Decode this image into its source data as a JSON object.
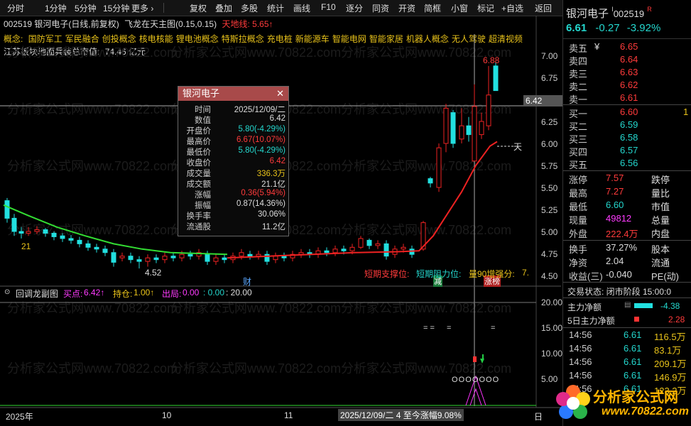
{
  "toolbar_left": [
    "分时",
    "1分钟",
    "5分钟",
    "15分钟",
    "更多 ›"
  ],
  "toolbar_right": [
    "复权",
    "叠加",
    "多股",
    "统计",
    "画线",
    "F10",
    "逐分",
    "同资",
    "开资",
    "简框",
    "小窗",
    "标记",
    "+自选",
    "返回"
  ],
  "chart_header": {
    "code": "002519",
    "name": "银河电子(日线,前复权)",
    "indicator": "飞龙在天主图(0.15,0.15)",
    "tiandi_label": "天地线:",
    "tiandi_value": "5.65↑"
  },
  "concepts": {
    "label": "概念:",
    "items": [
      "国防军工",
      "军民融合",
      "创投概念",
      "核电核能",
      "锂电池概念",
      "特斯拉概念",
      "充电桩",
      "新能源车",
      "智能电网",
      "智能家居",
      "机器人概念",
      "无人驾驶",
      "超清视频"
    ]
  },
  "info_line": {
    "region": "江苏板块地面兵装总市值:",
    "value": "74.46 亿元"
  },
  "watermark": "分析家公式网www.70822.com",
  "y_axis_main": [
    "7.00",
    "6.75",
    "6.50",
    "6.25",
    "6.00",
    "5.75",
    "5.50",
    "5.25",
    "5.00",
    "4.75",
    "4.50"
  ],
  "y_axis_lower": [
    "20.00",
    "15.00",
    "10.00",
    "5.00"
  ],
  "current_price_tag": "6.42",
  "chart_labels": {
    "peak": "6.88",
    "low_marker": "4.52",
    "start_level": "21",
    "tian_label": "天",
    "cai": "财",
    "jian": "减",
    "zhangbang": "涨榜",
    "short_support": "短期支撑位:",
    "short_resist": "短期阻力位:",
    "gain_strong": "量90增强分:",
    "gain_value": "7."
  },
  "popup": {
    "title": "银河电子",
    "close": "✕",
    "rows": [
      {
        "label": "时间",
        "value": "2025/12/09/二",
        "color": "white"
      },
      {
        "label": "数值",
        "value": "6.42",
        "color": "white"
      },
      {
        "label": "开盘价",
        "value": "5.80(-4.29%)",
        "color": "green"
      },
      {
        "label": "最高价",
        "value": "6.67(10.07%)",
        "color": "red"
      },
      {
        "label": "最低价",
        "value": "5.80(-4.29%)",
        "color": "green"
      },
      {
        "label": "收盘价",
        "value": "6.42",
        "color": "red"
      },
      {
        "label": "成交量",
        "value": "336.3万",
        "color": "yellow"
      },
      {
        "label": "成交额",
        "value": "21.1亿",
        "color": "white"
      },
      {
        "label": "涨幅",
        "value": "0.36(5.94%)",
        "color": "red"
      },
      {
        "label": "振幅",
        "value": "0.87(14.36%)",
        "color": "white"
      },
      {
        "label": "换手率",
        "value": "30.06%",
        "color": "white"
      },
      {
        "label": "流通股",
        "value": "11.2亿",
        "color": "white"
      }
    ]
  },
  "lower_header": {
    "name": "回调龙副图",
    "buy_label": "买点:",
    "buy_value": "6.42↑",
    "hold_label": "持仓:",
    "hold_value": "1.00↑",
    "out_label": "出局:",
    "out_value": "0.00",
    "extra1": ": 0.00",
    "extra2": ": 20.00"
  },
  "lower_marks": [
    "= =",
    "=",
    "=",
    "O O O O O O O"
  ],
  "x_axis": {
    "year": "2025年",
    "m10": "10",
    "m11": "11",
    "cursor_date": "2025/12/09/二  4 至今涨幅9.08%",
    "right": "日"
  },
  "right_panel": {
    "name": "银河电子",
    "code": "002519",
    "rzr": "R",
    "price": "6.61",
    "change": "-0.27",
    "pct": "-3.92%",
    "sell": [
      {
        "label": "卖五",
        "flag": "¥",
        "price": "6.65",
        "vol": ""
      },
      {
        "label": "卖四",
        "flag": "",
        "price": "6.64",
        "vol": ""
      },
      {
        "label": "卖三",
        "flag": "",
        "price": "6.63",
        "vol": ""
      },
      {
        "label": "卖二",
        "flag": "",
        "price": "6.62",
        "vol": ""
      },
      {
        "label": "卖一",
        "flag": "",
        "price": "6.61",
        "vol": ""
      }
    ],
    "buy": [
      {
        "label": "买一",
        "price": "6.60",
        "vol": "1"
      },
      {
        "label": "买二",
        "price": "6.59",
        "vol": ""
      },
      {
        "label": "买三",
        "price": "6.58",
        "vol": ""
      },
      {
        "label": "买四",
        "price": "6.57",
        "vol": ""
      },
      {
        "label": "买五",
        "price": "6.56",
        "vol": ""
      }
    ],
    "stats": [
      {
        "l": "涨停",
        "v": "7.57",
        "vc": "red",
        "l2": "跌停"
      },
      {
        "l": "最高",
        "v": "7.27",
        "vc": "red",
        "l2": "量比"
      },
      {
        "l": "最低",
        "v": "6.60",
        "vc": "green",
        "l2": "市值"
      },
      {
        "l": "现量",
        "v": "49812",
        "vc": "magenta",
        "l2": "总量"
      },
      {
        "l": "外盘",
        "v": "222.4万",
        "vc": "red",
        "l2": "内盘"
      }
    ],
    "stats2": [
      {
        "l": "换手",
        "v": "37.27%",
        "vc": "white",
        "l2": "股本"
      },
      {
        "l": "净资",
        "v": "2.04",
        "vc": "white",
        "l2": "流通"
      },
      {
        "l": "收益(三)",
        "v": "-0.040",
        "vc": "white",
        "l2": "PE(动)"
      }
    ],
    "trade_state": "交易状态: 闭市阶段 15:00:0",
    "main_net": {
      "label": "主力净额",
      "value": "-4.38"
    },
    "main_net5": {
      "label": "5日主力净额",
      "value": "2.28"
    },
    "ticks": [
      {
        "t": "14:56",
        "p": "6.61",
        "v": "116.5万"
      },
      {
        "t": "14:56",
        "p": "6.61",
        "v": "83.1万"
      },
      {
        "t": "14:56",
        "p": "6.61",
        "v": "209.1万"
      },
      {
        "t": "14:56",
        "p": "6.61",
        "v": "146.9万"
      },
      {
        "t": "14:56",
        "p": "6.61",
        "v": "123.2万"
      }
    ]
  },
  "logo": {
    "title": "分析家公式网",
    "url": "www.70822.com"
  }
}
